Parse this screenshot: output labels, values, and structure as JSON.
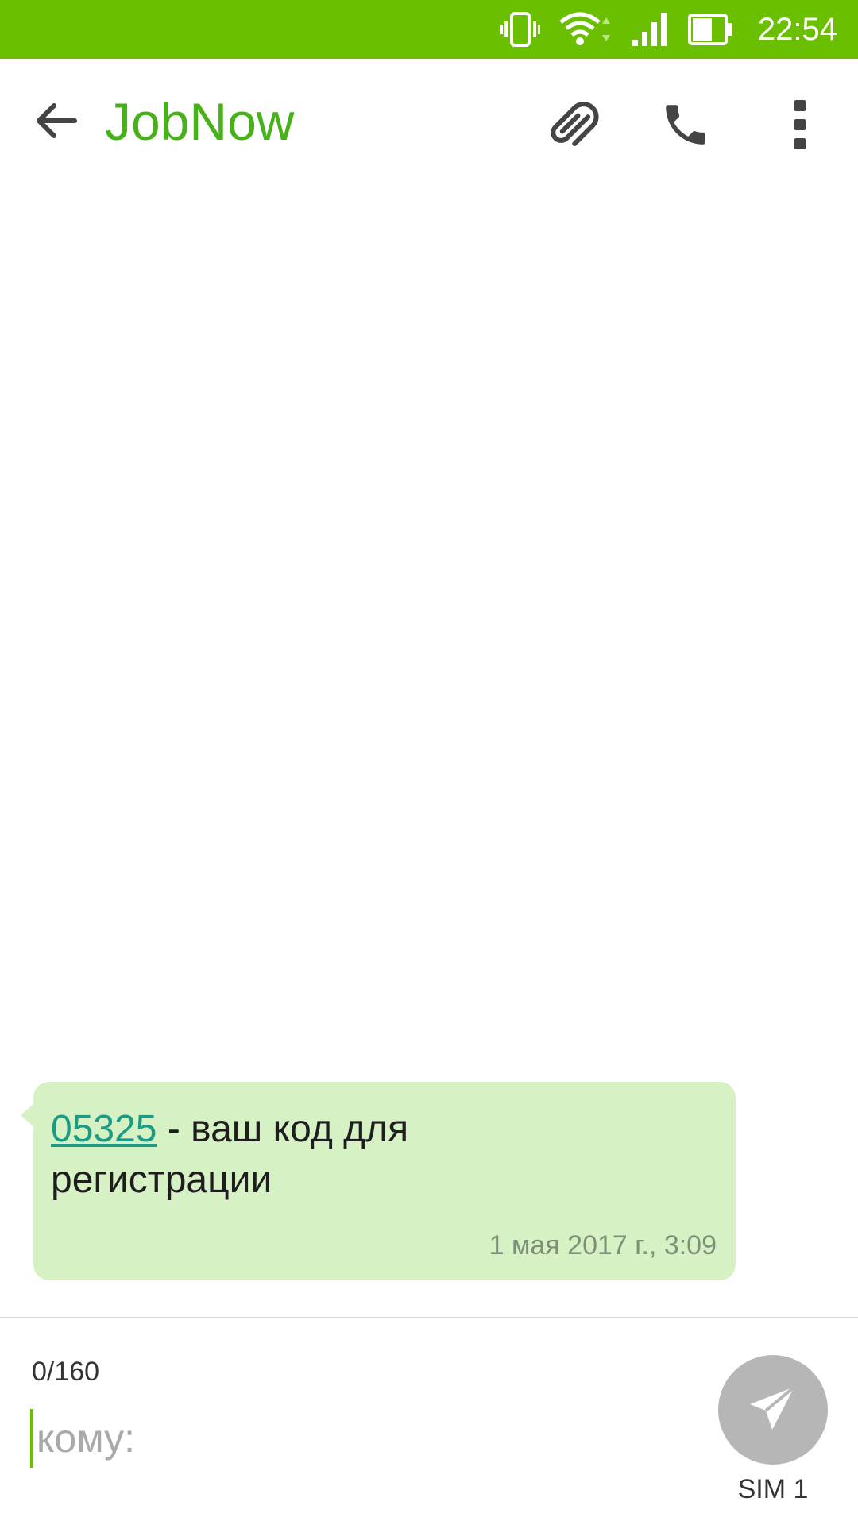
{
  "status_bar": {
    "time": "22:54",
    "color": "#6ac000",
    "icons": [
      "vibrate-icon",
      "wifi-icon",
      "signal-icon",
      "battery-icon"
    ]
  },
  "toolbar": {
    "title": "JobNow",
    "title_color": "#47b11a",
    "back_icon": "arrow-back-icon",
    "actions": [
      "paperclip-icon",
      "phone-icon",
      "more-vert-icon"
    ]
  },
  "messages": [
    {
      "code": "05325",
      "text": " - ваш код для регистрации",
      "timestamp": "1 мая 2017 г., 3:09",
      "bubble_color": "#d6f2c4",
      "link_color": "#1b9a86"
    }
  ],
  "compose": {
    "char_count": "0/160",
    "recipient_placeholder": "кому:",
    "send_icon": "send-icon",
    "sim_label": "SIM 1"
  }
}
